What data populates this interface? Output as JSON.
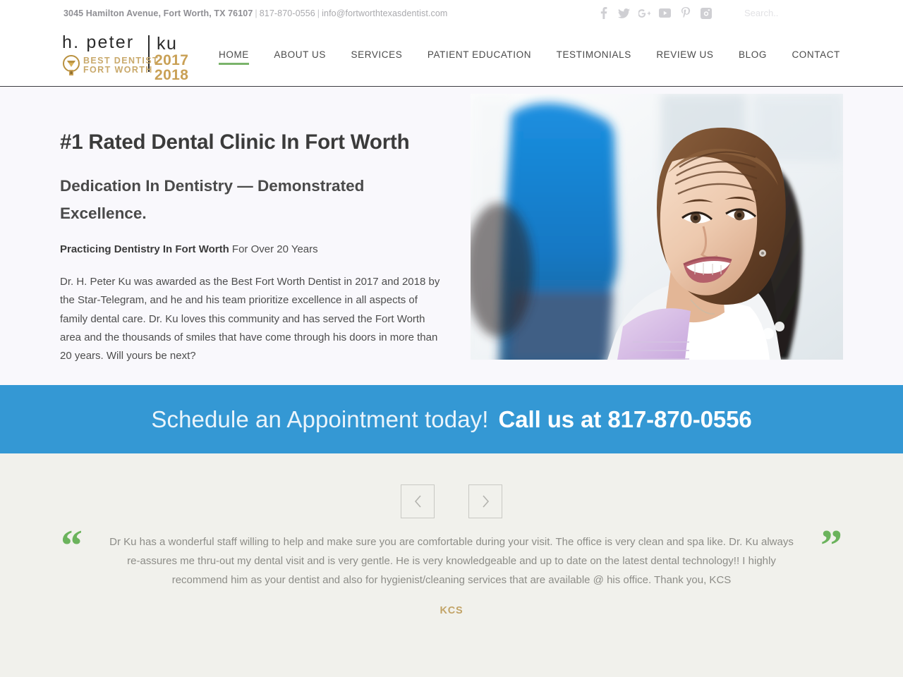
{
  "topbar": {
    "address": "3045 Hamilton Avenue, Fort Worth, TX 76107",
    "separator": "|",
    "phone": "817-870-0556",
    "email": "info@fortworthtexasdentist.com",
    "social": [
      {
        "name": "facebook-icon",
        "label": "Facebook"
      },
      {
        "name": "twitter-icon",
        "label": "Twitter"
      },
      {
        "name": "google-plus-icon",
        "label": "Google Plus"
      },
      {
        "name": "youtube-icon",
        "label": "YouTube"
      },
      {
        "name": "pinterest-icon",
        "label": "Pinterest"
      },
      {
        "name": "instagram-icon",
        "label": "Instagram"
      }
    ],
    "search_placeholder": "Search..",
    "search_value": ""
  },
  "logo": {
    "name_first": "h. peter",
    "name_last": "ku",
    "badge_line1": "BEST DENTIST",
    "badge_line2": "FORT WORTH",
    "year1": "2017",
    "year2": "2018"
  },
  "nav": {
    "items": [
      {
        "label": "HOME",
        "active": true
      },
      {
        "label": "ABOUT US",
        "active": false
      },
      {
        "label": "SERVICES",
        "active": false
      },
      {
        "label": "PATIENT EDUCATION",
        "active": false
      },
      {
        "label": "TESTIMONIALS",
        "active": false
      },
      {
        "label": "REVIEW US",
        "active": false
      },
      {
        "label": "BLOG",
        "active": false
      },
      {
        "label": "CONTACT",
        "active": false
      }
    ]
  },
  "hero": {
    "heading": "#1 Rated Dental Clinic In Fort Worth",
    "subheading": "Dedication In Dentistry — Demonstrated Excellence.",
    "tagline_bold": "Practicing Dentistry In Fort Worth",
    "tagline_rest": " For Over 20 Years",
    "paragraph": "Dr. H. Peter Ku was awarded as the Best Fort Worth Dentist in 2017 and 2018 by the Star-Telegram, and he and his team prioritize excellence in all aspects of family dental care. Dr. Ku loves this community and has served the Fort Worth area and the thousands of smiles that have come through his doors in more than 20 years. Will yours be next?",
    "image_alt": "Smiling woman patient in dental chair with dentist in blue scrubs"
  },
  "cta": {
    "text_light": "Schedule an Appointment today!",
    "text_bold": "Call us at 817-870-0556",
    "background": "#3498d4"
  },
  "testimonial": {
    "prev_label": "‹",
    "next_label": "›",
    "quote_open": "“",
    "quote_close": "”",
    "text": "Dr Ku has a wonderful staff willing to help and make sure you are comfortable during your visit. The office is very clean and spa like. Dr. Ku always re-assures me thru-out my dental visit and is very gentle. He is very knowledgeable and up to date on the latest dental technology!! I highly recommend him as your dentist and also for hygienist/cleaning services that are available @ his office. Thank you, KCS",
    "author": "KCS",
    "accent_color": "#6bb35c",
    "author_color": "#c2a468"
  }
}
